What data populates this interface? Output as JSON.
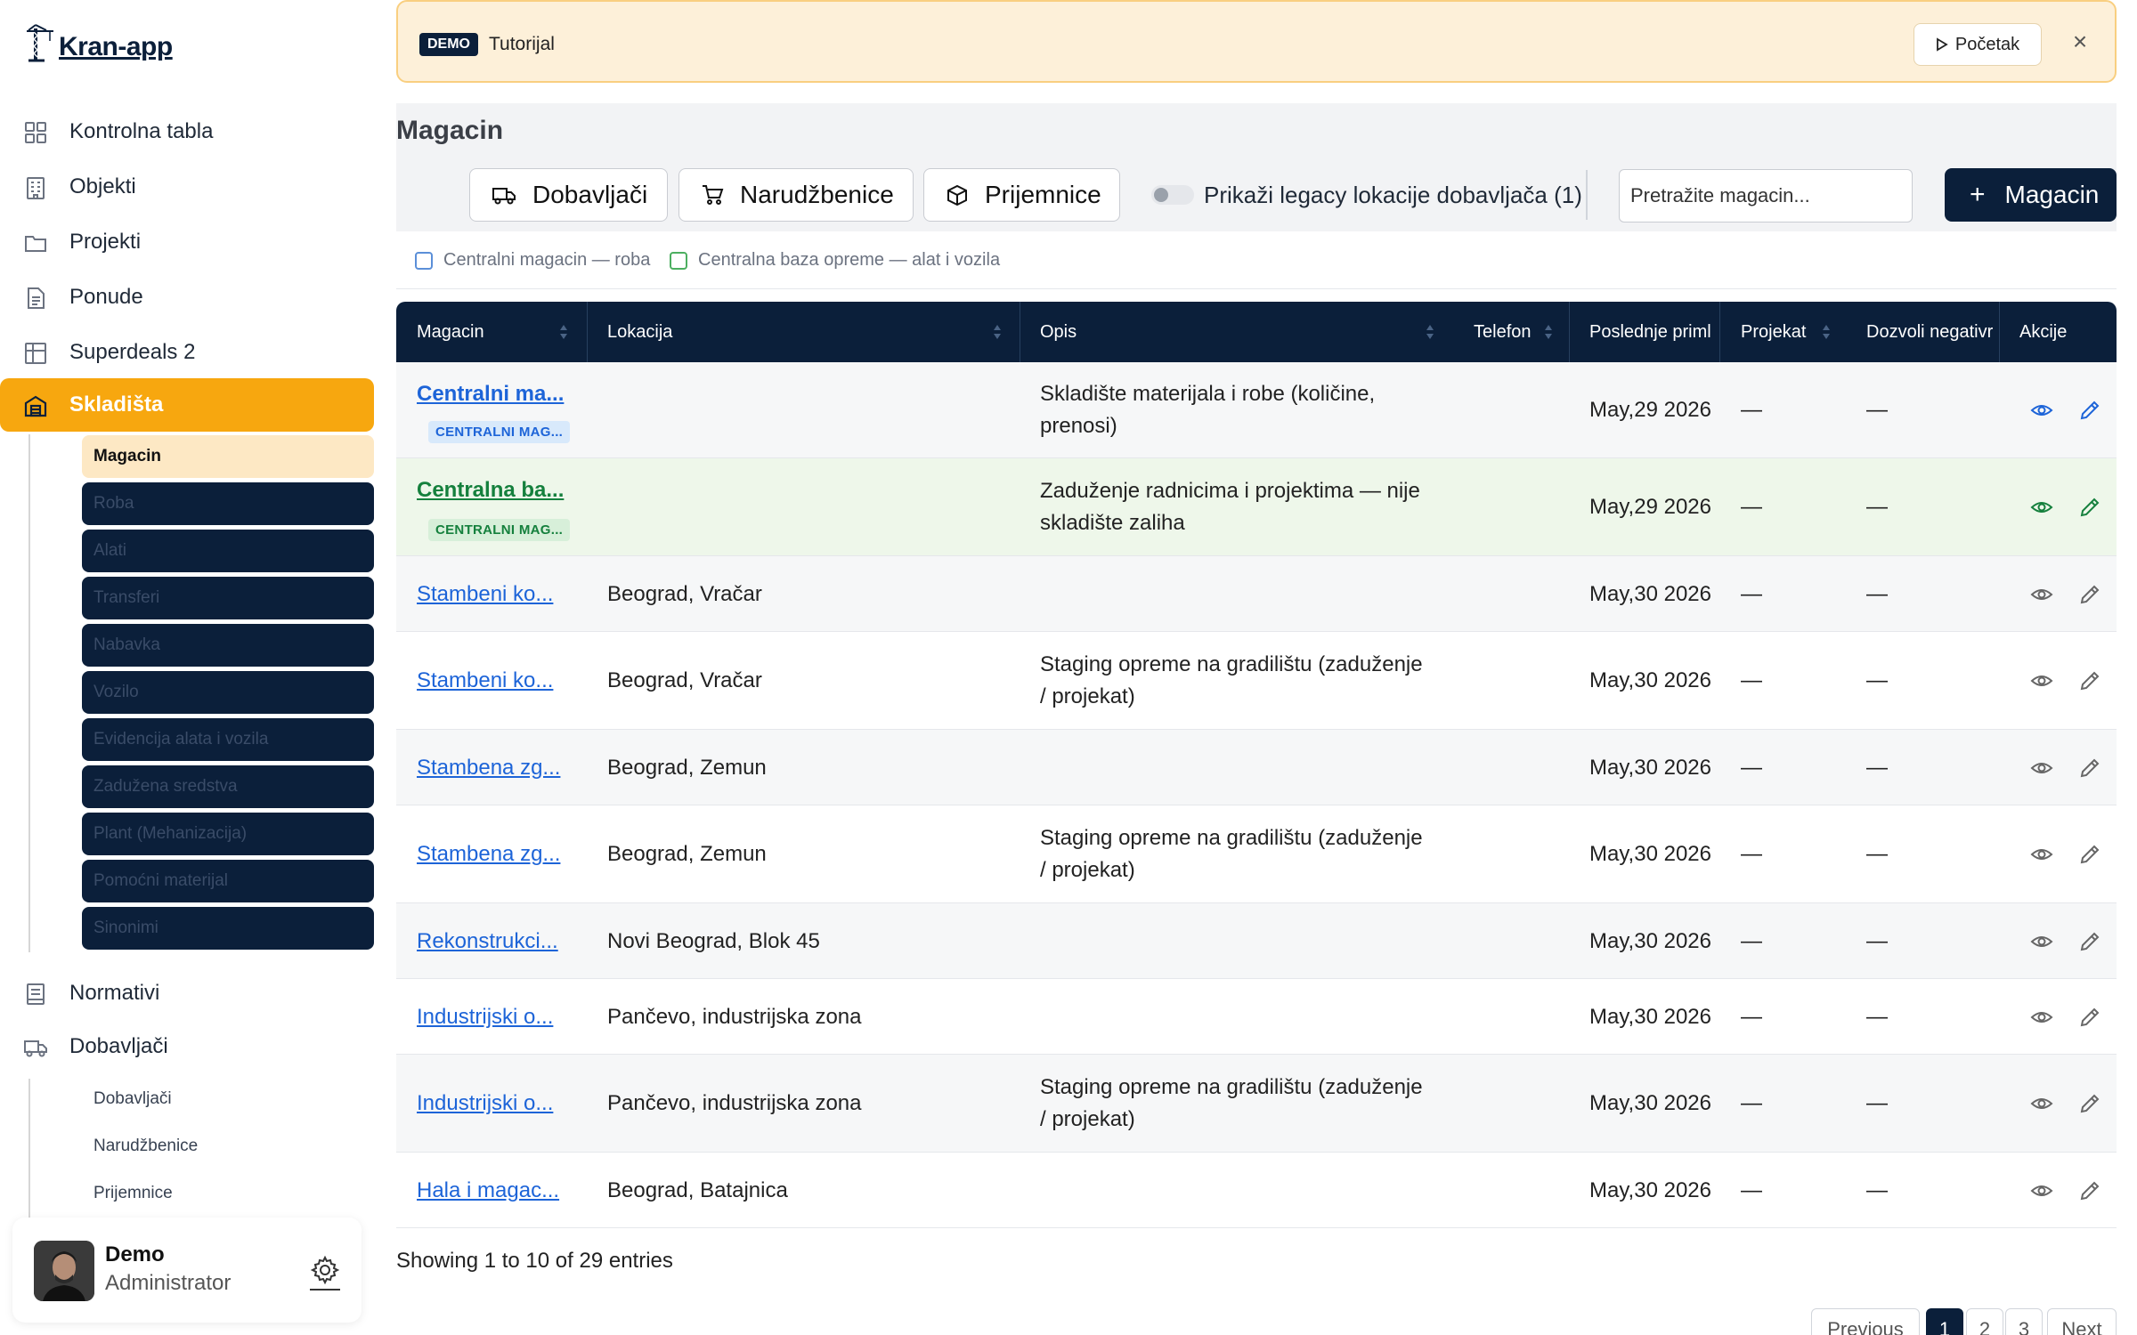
{
  "sidebar": {
    "logo_text": "Kran-app",
    "nav": [
      {
        "label": "Kontrolna tabla",
        "icon": "dashboard-icon"
      },
      {
        "label": "Objekti",
        "icon": "building-icon"
      },
      {
        "label": "Projekti",
        "icon": "folder-icon"
      },
      {
        "label": "Ponude",
        "icon": "document-icon"
      },
      {
        "label": "Superdeals 2",
        "icon": "grid-table-icon"
      },
      {
        "label": "Skladišta",
        "icon": "warehouse-icon",
        "active": true
      }
    ],
    "skladista_sub": [
      {
        "label": "Magacin",
        "active": true
      },
      {
        "label": "Roba"
      },
      {
        "label": "Alati"
      },
      {
        "label": "Transferi"
      },
      {
        "label": "Nabavka"
      },
      {
        "label": "Vozilo"
      },
      {
        "label": "Evidencija alata i vozila"
      },
      {
        "label": "Zadužena sredstva"
      },
      {
        "label": "Plant (Mehanizacija)"
      },
      {
        "label": "Pomoćni materijal"
      },
      {
        "label": "Sinonimi"
      }
    ],
    "nav_after": [
      {
        "label": "Normativi",
        "icon": "book-icon"
      },
      {
        "label": "Dobavljači",
        "icon": "truck-icon"
      }
    ],
    "dobavljaci_sub": [
      {
        "label": "Dobavljači"
      },
      {
        "label": "Narudžbenice"
      },
      {
        "label": "Prijemnice"
      }
    ],
    "user": {
      "name": "Demo",
      "role": "Administrator"
    }
  },
  "banner": {
    "badge": "DEMO",
    "title": "Tutorijal",
    "start_label": "Početak",
    "close_symbol": "×"
  },
  "header": {
    "title": "Magacin",
    "buttons": [
      {
        "label": "Dobavljači",
        "icon": "truck-icon"
      },
      {
        "label": "Narudžbenice",
        "icon": "cart-icon"
      },
      {
        "label": "Prijemnice",
        "icon": "box-icon"
      }
    ],
    "toggle_label": "Prikaži legacy lokacije dobavljača (1)",
    "toggle_on": false,
    "search_placeholder": "Pretražite magacin...",
    "add_label": "Magacin"
  },
  "filters": [
    {
      "label": "Centralni magacin — roba",
      "color": "#1d64d8"
    },
    {
      "label": "Centralna baza opreme — alat i vozila",
      "color": "#15803d"
    }
  ],
  "table": {
    "columns": [
      "Magacin",
      "Lokacija",
      "Opis",
      "Telefon",
      "Poslednje priml",
      "Projekat",
      "Dozvoli negativr",
      "Akcije"
    ],
    "rows": [
      {
        "name": "Centralni ma...",
        "tag": "CENTRALNI MAG...",
        "tag_color": "blue",
        "location": "",
        "desc": "Skladište materijala i robe (količine, prenosi)",
        "phone": "",
        "last": "May,29 2026",
        "project": "—",
        "negative": "—",
        "variant": "blue"
      },
      {
        "name": "Centralna ba...",
        "tag": "CENTRALNI MAG...",
        "tag_color": "green",
        "location": "",
        "desc": "Zaduženje radnicima i projektima — nije skladište zaliha",
        "phone": "",
        "last": "May,29 2026",
        "project": "—",
        "negative": "—",
        "variant": "green"
      },
      {
        "name": "Stambeni ko...",
        "tag": "",
        "location": "Beograd, Vračar",
        "desc": "",
        "phone": "",
        "last": "May,30 2026",
        "project": "—",
        "negative": "—",
        "variant": "plain"
      },
      {
        "name": "Stambeni ko...",
        "tag": "",
        "location": "Beograd, Vračar",
        "desc": "Staging opreme na gradilištu (zaduženje / projekat)",
        "phone": "",
        "last": "May,30 2026",
        "project": "—",
        "negative": "—",
        "variant": "plain"
      },
      {
        "name": "Stambena zg...",
        "tag": "",
        "location": "Beograd, Zemun",
        "desc": "",
        "phone": "",
        "last": "May,30 2026",
        "project": "—",
        "negative": "—",
        "variant": "plain"
      },
      {
        "name": "Stambena zg...",
        "tag": "",
        "location": "Beograd, Zemun",
        "desc": "Staging opreme na gradilištu (zaduženje / projekat)",
        "phone": "",
        "last": "May,30 2026",
        "project": "—",
        "negative": "—",
        "variant": "plain"
      },
      {
        "name": "Rekonstrukci...",
        "tag": "",
        "location": "Novi Beograd, Blok 45",
        "desc": "",
        "phone": "",
        "last": "May,30 2026",
        "project": "—",
        "negative": "—",
        "variant": "plain"
      },
      {
        "name": "Industrijski o...",
        "tag": "",
        "location": "Pančevo, industrijska zona",
        "desc": "",
        "phone": "",
        "last": "May,30 2026",
        "project": "—",
        "negative": "—",
        "variant": "plain"
      },
      {
        "name": "Industrijski o...",
        "tag": "",
        "location": "Pančevo, industrijska zona",
        "desc": "Staging opreme na gradilištu (zaduženje / projekat)",
        "phone": "",
        "last": "May,30 2026",
        "project": "—",
        "negative": "—",
        "variant": "plain"
      },
      {
        "name": "Hala i magac...",
        "tag": "",
        "location": "Beograd, Batajnica",
        "desc": "",
        "phone": "",
        "last": "May,30 2026",
        "project": "—",
        "negative": "—",
        "variant": "plain"
      }
    ],
    "showing": "Showing 1 to 10 of 29 entries"
  },
  "pagination": {
    "previous": "Previous",
    "pages": [
      "1",
      "2",
      "3"
    ],
    "current": "1",
    "next": "Next"
  },
  "colors": {
    "navy": "#0b1f3a",
    "accent": "#f7a70f",
    "link_blue": "#1d64d8",
    "link_green": "#15803d",
    "banner_bg": "#fdf0d9"
  }
}
